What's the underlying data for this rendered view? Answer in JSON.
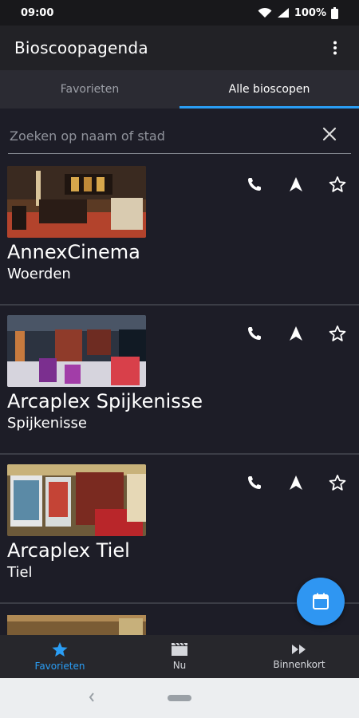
{
  "status": {
    "time": "09:00",
    "battery": "100%"
  },
  "appbar": {
    "title": "Bioscoopagenda"
  },
  "tabs": [
    {
      "label": "Favorieten"
    },
    {
      "label": "Alle bioscopen"
    }
  ],
  "search": {
    "placeholder": "Zoeken op naam of stad"
  },
  "cinemas": [
    {
      "name": "AnnexCinema",
      "city": "Woerden"
    },
    {
      "name": "Arcaplex Spijkenisse",
      "city": "Spijkenisse"
    },
    {
      "name": "Arcaplex Tiel",
      "city": "Tiel"
    }
  ],
  "bottom_nav": [
    {
      "label": "Favorieten"
    },
    {
      "label": "Nu"
    },
    {
      "label": "Binnenkort"
    }
  ],
  "colors": {
    "accent": "#2a9df4",
    "background": "#1d1d27"
  }
}
